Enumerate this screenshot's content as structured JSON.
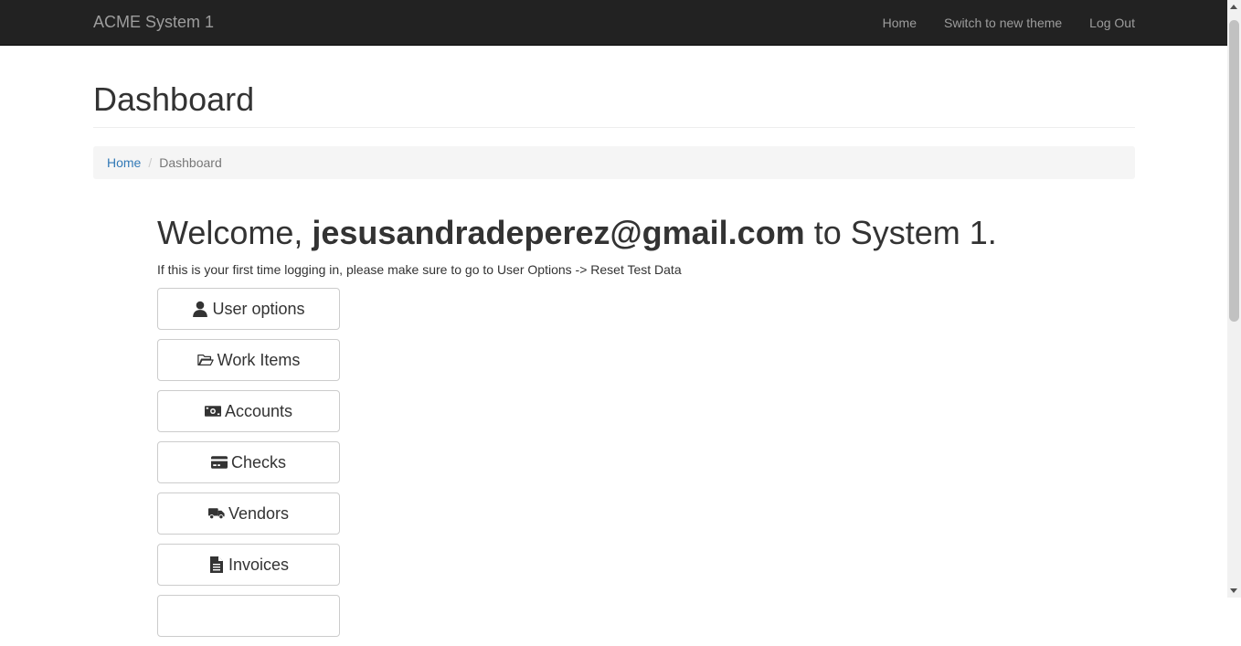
{
  "navbar": {
    "brand": "ACME System 1",
    "links": [
      "Home",
      "Switch to new theme",
      "Log Out"
    ]
  },
  "page": {
    "title": "Dashboard"
  },
  "breadcrumb": {
    "home": "Home",
    "current": "Dashboard"
  },
  "welcome": {
    "prefix": "Welcome, ",
    "email": "jesusandradeperez@gmail.com",
    "suffix": " to System 1.",
    "hint": "If this is your first time logging in, please make sure to go to User Options -> Reset Test Data"
  },
  "menu": [
    {
      "label": "User options",
      "icon": "user-icon"
    },
    {
      "label": "Work Items",
      "icon": "folder-open-icon"
    },
    {
      "label": "Accounts",
      "icon": "money-icon"
    },
    {
      "label": "Checks",
      "icon": "credit-card-icon"
    },
    {
      "label": "Vendors",
      "icon": "truck-icon"
    },
    {
      "label": "Invoices",
      "icon": "file-text-icon"
    }
  ]
}
